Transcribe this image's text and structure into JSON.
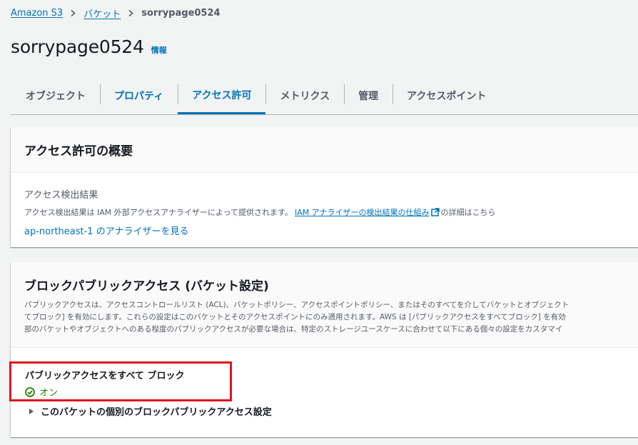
{
  "breadcrumb": {
    "items": [
      "Amazon S3",
      "バケット"
    ],
    "current": "sorrypage0524"
  },
  "header": {
    "title": "sorrypage0524",
    "info_label": "情報"
  },
  "tabs": [
    {
      "label": "オブジェクト",
      "active": false
    },
    {
      "label": "プロパティ",
      "active": false
    },
    {
      "label": "アクセス許可",
      "active": true
    },
    {
      "label": "メトリクス",
      "active": false
    },
    {
      "label": "管理",
      "active": false
    },
    {
      "label": "アクセスポイント",
      "active": false
    }
  ],
  "permissions_overview": {
    "title": "アクセス許可の概要",
    "findings_label": "アクセス検出結果",
    "findings_desc_prefix": "アクセス検出結果は IAM 外部アクセスアナライザーによって提供されます。",
    "findings_link": "IAM アナライザーの検出結果の仕組み",
    "findings_desc_suffix": "の詳細はこちら",
    "analyzer_link": "ap-northeast-1 のアナライザーを見る"
  },
  "block_public_access": {
    "title": "ブロックパブリックアクセス (バケット設定)",
    "description_lines": [
      "パブリックアクセスは、アクセスコントロールリスト (ACL)、バケットポリシー、アクセスポイントポリシー、またはそのすべてを介してバケットとオブジェクト",
      "てブロック] を有効にします。これらの設定はこのバケットとそのアクセスポイントにのみ適用されます。AWS は [パブリックアクセスをすべてブロック] を有効",
      "部のバケットやオブジェクトへのある程度のパブリックアクセスが必要な場合は、特定のストレージユースケースに合わせて以下にある個々の設定をカスタマイ"
    ],
    "block_all_label": "パブリックアクセスをすべて ブロック",
    "status": "オン",
    "expander_label": "このバケットの個別のブロックパブリックアクセス設定"
  },
  "colors": {
    "link": "#0073bb",
    "status_ok": "#1d8102",
    "highlight_box": "#e0141e"
  }
}
